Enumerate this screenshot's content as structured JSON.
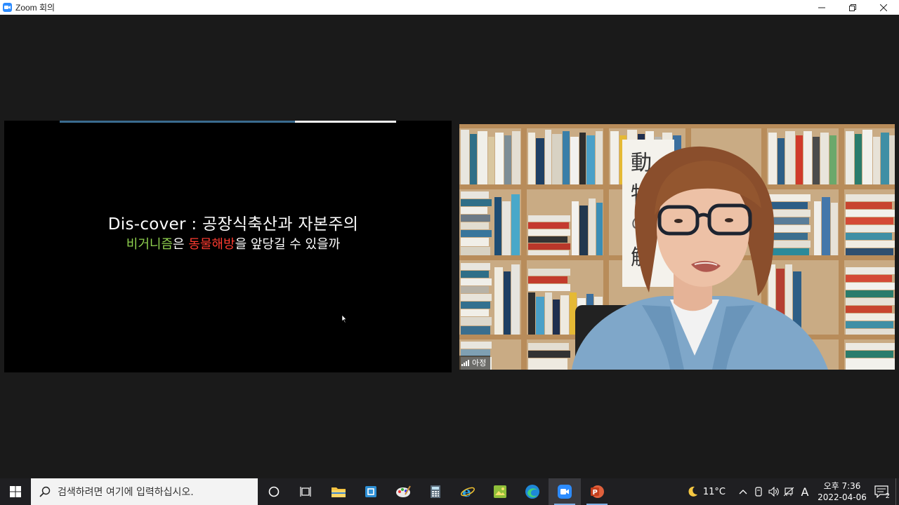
{
  "window": {
    "title": "Zoom 회의",
    "minimize_label": "—",
    "restore_label": "❐",
    "close_label": "✕"
  },
  "slide": {
    "title": "Dis-cover : 공장식축산과 자본주의",
    "subtitle_part1": "비거니즘",
    "subtitle_part2": "은 ",
    "subtitle_part3": "동물해방",
    "subtitle_part4": "을 앞당길 수 있을까",
    "colors": {
      "green": "#8fd14f",
      "red": "#ff3b30"
    }
  },
  "participant": {
    "name": "아정",
    "signal_bars": 4,
    "book_spine_text": "動物の解"
  },
  "taskbar": {
    "search_placeholder": "검색하려면 여기에 입력하십시오.",
    "apps": [
      "cortana-icon",
      "task-view-icon",
      "file-explorer-icon",
      "store-icon",
      "paint-icon",
      "calculator-icon",
      "ie-icon",
      "photos-icon",
      "edge-icon",
      "zoom-icon",
      "powerpoint-icon"
    ],
    "active_app": "zoom-icon"
  },
  "tray": {
    "temperature": "11°C",
    "ime_label": "A",
    "time": "오후 7:36",
    "date": "2022-04-06",
    "notification_count": "2"
  }
}
